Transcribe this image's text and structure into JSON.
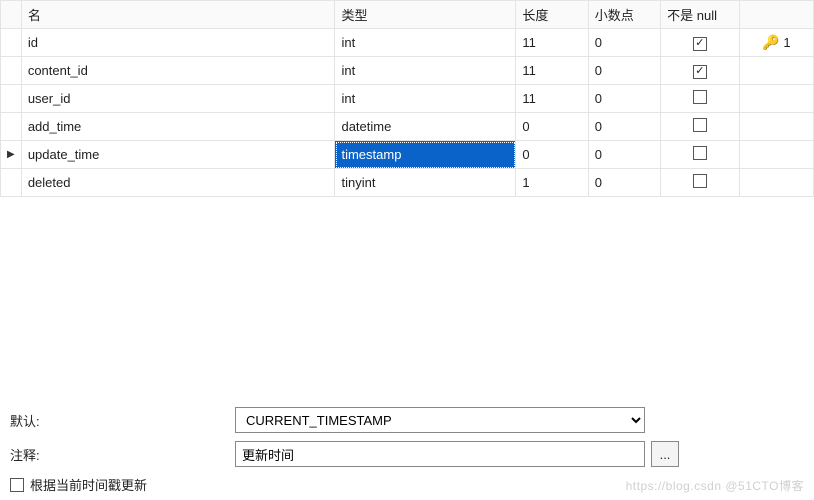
{
  "columns_header": {
    "name": "名",
    "type": "类型",
    "length": "长度",
    "decimals": "小数点",
    "not_null": "不是 null"
  },
  "rows": [
    {
      "name": "id",
      "type": "int",
      "len": "11",
      "dec": "0",
      "nn": true,
      "pk": true,
      "pk_num": "1",
      "cursor": false
    },
    {
      "name": "content_id",
      "type": "int",
      "len": "11",
      "dec": "0",
      "nn": true,
      "pk": false,
      "pk_num": "",
      "cursor": false
    },
    {
      "name": "user_id",
      "type": "int",
      "len": "11",
      "dec": "0",
      "nn": false,
      "pk": false,
      "pk_num": "",
      "cursor": false
    },
    {
      "name": "add_time",
      "type": "datetime",
      "len": "0",
      "dec": "0",
      "nn": false,
      "pk": false,
      "pk_num": "",
      "cursor": false
    },
    {
      "name": "update_time",
      "type": "timestamp",
      "len": "0",
      "dec": "0",
      "nn": false,
      "pk": false,
      "pk_num": "",
      "cursor": true
    },
    {
      "name": "deleted",
      "type": "tinyint",
      "len": "1",
      "dec": "0",
      "nn": false,
      "pk": false,
      "pk_num": "",
      "cursor": false
    }
  ],
  "selected_cell": {
    "row": 4,
    "col": "type"
  },
  "form": {
    "default_label": "默认:",
    "default_value": "CURRENT_TIMESTAMP",
    "comment_label": "注释:",
    "comment_value": "更新时间",
    "ellipsis": "...",
    "auto_update_label": "根据当前时间戳更新",
    "auto_update_checked": false
  },
  "watermark": "https://blog.csdn  @51CTO博客"
}
